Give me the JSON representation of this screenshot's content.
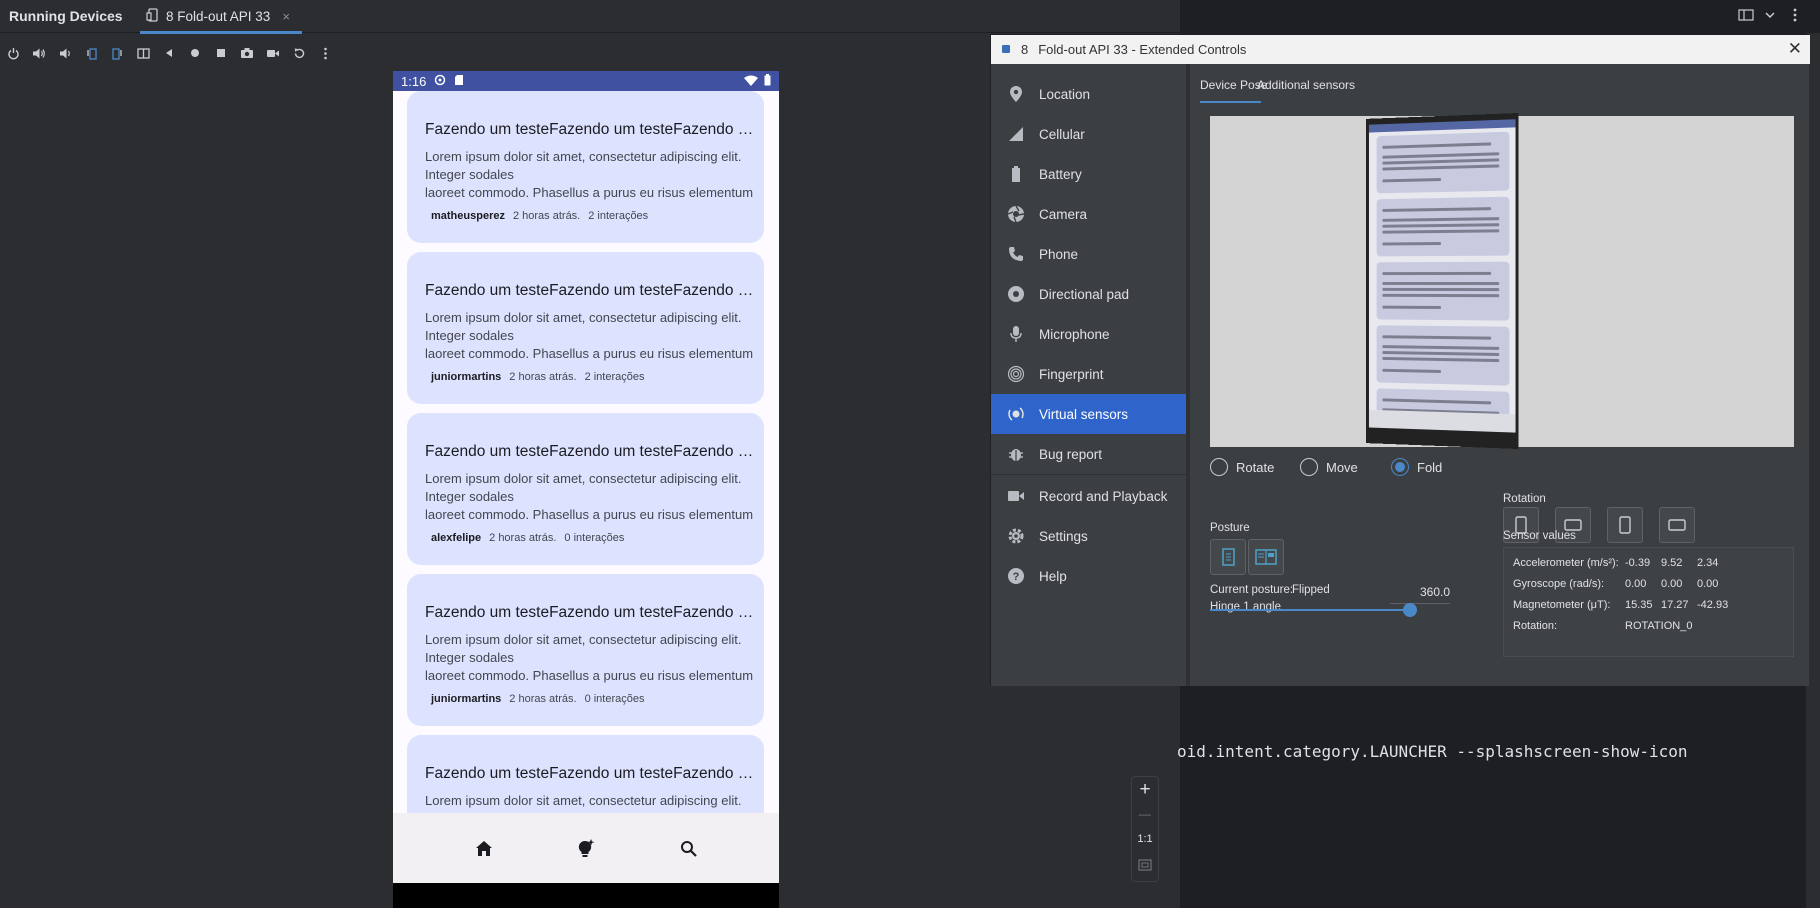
{
  "app": {
    "panel_title": "Running Devices",
    "tab_label": "8 Fold-out API 33",
    "tab_close": "×"
  },
  "toolbar": {
    "icons": [
      "power-icon",
      "volume-up-icon",
      "volume-down-icon",
      "rotate-left-icon",
      "rotate-right-icon",
      "fold-icon",
      "back-icon",
      "home-icon",
      "overview-icon",
      "screenshot-icon",
      "screen-record-icon",
      "reset-icon",
      "more-icon"
    ]
  },
  "terminal": {
    "command": "oid.intent.category.LAUNCHER --splashscreen-show-icon"
  },
  "phone": {
    "time": "1:16",
    "cards": [
      {
        "title": "Fazendo um testeFazendo um testeFazendo um teste",
        "body1": "Lorem ipsum dolor sit amet, consectetur adipiscing elit.",
        "body2": "Integer sodales",
        "body3": "laoreet commodo. Phasellus a purus eu risus elementum",
        "user": "matheusperez",
        "time": "2 horas atrás.",
        "interactions": "2 interações"
      },
      {
        "title": "Fazendo um testeFazendo um testeFazendo um teste",
        "body1": "Lorem ipsum dolor sit amet, consectetur adipiscing elit.",
        "body2": "Integer sodales",
        "body3": "laoreet commodo. Phasellus a purus eu risus elementum",
        "user": "juniormartins",
        "time": "2 horas atrás.",
        "interactions": "2 interações"
      },
      {
        "title": "Fazendo um testeFazendo um testeFazendo um teste",
        "body1": "Lorem ipsum dolor sit amet, consectetur adipiscing elit.",
        "body2": "Integer sodales",
        "body3": "laoreet commodo. Phasellus a purus eu risus elementum",
        "user": "alexfelipe",
        "time": "2 horas atrás.",
        "interactions": "0 interações"
      },
      {
        "title": "Fazendo um testeFazendo um testeFazendo um teste",
        "body1": "Lorem ipsum dolor sit amet, consectetur adipiscing elit.",
        "body2": "Integer sodales",
        "body3": "laoreet commodo. Phasellus a purus eu risus elementum",
        "user": "juniormartins",
        "time": "2 horas atrás.",
        "interactions": "0 interações"
      },
      {
        "title": "Fazendo um testeFazendo um testeFazendo um teste",
        "body1": "Lorem ipsum dolor sit amet, consectetur adipiscing elit.",
        "body2": "",
        "body3": "",
        "user": "",
        "time": "",
        "interactions": ""
      }
    ],
    "nav": [
      "home-icon",
      "lightbulb-icon",
      "search-icon"
    ]
  },
  "zoom": {
    "plus": "+",
    "minus": "—",
    "one_to_one": "1:1"
  },
  "extended_controls": {
    "window_number": "8",
    "window_title": "Fold-out API 33 - Extended Controls",
    "nav": [
      {
        "label": "Location",
        "icon": "location-pin-icon"
      },
      {
        "label": "Cellular",
        "icon": "cellular-signal-icon"
      },
      {
        "label": "Battery",
        "icon": "battery-icon"
      },
      {
        "label": "Camera",
        "icon": "camera-aperture-icon"
      },
      {
        "label": "Phone",
        "icon": "phone-icon"
      },
      {
        "label": "Directional pad",
        "icon": "dpad-icon"
      },
      {
        "label": "Microphone",
        "icon": "microphone-icon"
      },
      {
        "label": "Fingerprint",
        "icon": "fingerprint-icon"
      },
      {
        "label": "Virtual sensors",
        "icon": "virtual-sensors-icon"
      },
      {
        "label": "Bug report",
        "icon": "bug-icon"
      },
      {
        "label": "Record and Playback",
        "icon": "video-camera-icon"
      },
      {
        "label": "Settings",
        "icon": "gear-icon"
      },
      {
        "label": "Help",
        "icon": "help-icon"
      }
    ],
    "selected": "Virtual sensors",
    "tabs": [
      "Device Pose",
      "Additional sensors"
    ],
    "modes": [
      "Rotate",
      "Move",
      "Fold"
    ],
    "selected_mode": "Fold",
    "posture_label": "Posture",
    "current_posture_label": "Current posture:",
    "current_posture_value": "Flipped",
    "hinge_label": "Hinge 1 angle",
    "hinge_value": "360.0",
    "hinge_fraction": 1.0,
    "rotation_label": "Rotation",
    "sensor_values_label": "Sensor values",
    "sensors": [
      {
        "name": "Accelerometer (m/s²):",
        "values": [
          "-0.39",
          "9.52",
          "2.34"
        ]
      },
      {
        "name": "Gyroscope (rad/s):",
        "values": [
          "0.00",
          "0.00",
          "0.00"
        ]
      },
      {
        "name": "Magnetometer (μT):",
        "values": [
          "15.35",
          "17.27",
          "-42.93"
        ]
      },
      {
        "name": "Rotation:",
        "values": [
          "ROTATION_0"
        ]
      }
    ],
    "accent_color": "#2f65ca"
  }
}
